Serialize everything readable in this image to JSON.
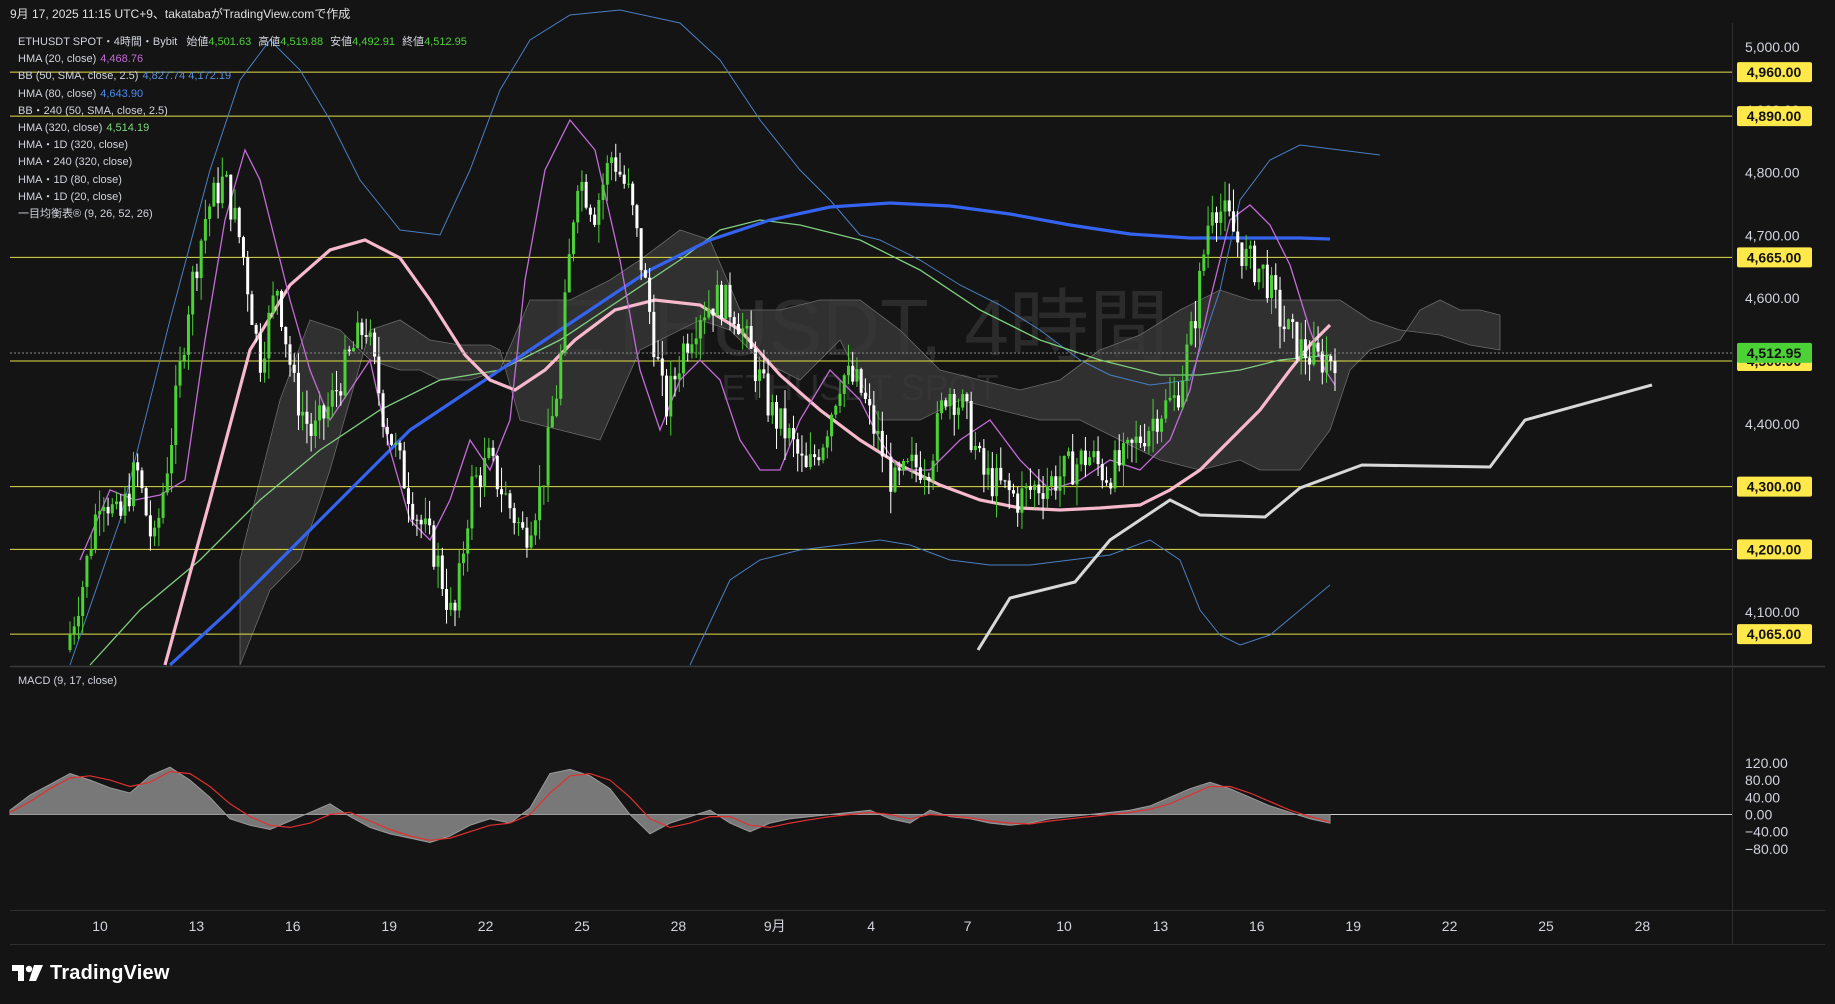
{
  "header": {
    "caption": "9月 17, 2025 11:15 UTC+9、takatabaがTradingView.comで作成"
  },
  "watermark": {
    "title": "ETHUSDT, 4時間",
    "subtitle": "ETHUSDT SPOT"
  },
  "legend": {
    "ohlc": {
      "symbol": "ETHUSDT SPOT・4時間・Bybit",
      "open_label": "始値",
      "open": "4,501.63",
      "high_label": "高値",
      "high": "4,519.88",
      "low_label": "安値",
      "low": "4,492.91",
      "close_label": "終値",
      "close": "4,512.95"
    },
    "indicators": [
      {
        "label": "HMA (20, close)",
        "value": "4,468.76",
        "color": "#c36bd8"
      },
      {
        "label": "BB (50, SMA, close, 2.5)",
        "value": "4,827.74  4,172.19",
        "color": "#5b8fd6"
      },
      {
        "label": "HMA (80, close)",
        "value": "4,643.90",
        "color": "#4a8cf0"
      },
      {
        "label": "BB・240 (50, SMA, close, 2.5)",
        "value": "",
        "color": "#5b8fd6"
      },
      {
        "label": "HMA (320, close)",
        "value": "4,514.19",
        "color": "#7ed67e"
      },
      {
        "label": "HMA・1D (320, close)",
        "value": "",
        "color": "#d1d4dc"
      },
      {
        "label": "HMA・240 (320, close)",
        "value": "",
        "color": "#d1d4dc"
      },
      {
        "label": "HMA・1D (80, close)",
        "value": "",
        "color": "#d1d4dc"
      },
      {
        "label": "HMA・1D (20, close)",
        "value": "",
        "color": "#d1d4dc"
      },
      {
        "label": "一目均衡表® (9, 26, 52, 26)",
        "value": "",
        "color": "#d1d4dc"
      }
    ]
  },
  "macd": {
    "label": "MACD (9, 17, close)"
  },
  "brand": {
    "name": "TradingView"
  },
  "colors": {
    "bg": "#141414",
    "up": "#4cd137",
    "down": "#ffffff",
    "level": "#e5e04a",
    "badge": "#ffe94a",
    "current": "#4cd137"
  },
  "chart_data": [
    {
      "type": "line",
      "title": "ETHUSDT, 4時間",
      "yaxis_ticks": [
        "5,000.00",
        "4,900.00",
        "4,800.00",
        "4,700.00",
        "4,600.00",
        "4,400.00",
        "4,100.00"
      ],
      "ylim": [
        4040,
        5025
      ],
      "xaxis_ticks": [
        "10",
        "13",
        "16",
        "19",
        "22",
        "25",
        "28",
        "9月",
        "4",
        "7",
        "10",
        "13",
        "16",
        "19",
        "22",
        "25",
        "28"
      ],
      "horizontal_levels": [
        {
          "price": 4960,
          "label": "4,960.00"
        },
        {
          "price": 4890,
          "label": "4,890.00"
        },
        {
          "price": 4665,
          "label": "4,665.00"
        },
        {
          "price": 4500,
          "label": "4,500.00"
        },
        {
          "price": 4300,
          "label": "4,300.00"
        },
        {
          "price": 4200,
          "label": "4,200.00"
        },
        {
          "price": 4065,
          "label": "4,065.00"
        }
      ],
      "current_price": {
        "price": 4512.95,
        "label": "4,512.95"
      },
      "price_path": [
        [
          0,
          4040
        ],
        [
          1,
          4150
        ],
        [
          2,
          4300
        ],
        [
          3,
          4240
        ],
        [
          4,
          4330
        ],
        [
          5,
          4200
        ],
        [
          6,
          4380
        ],
        [
          7,
          4600
        ],
        [
          8,
          4740
        ],
        [
          9,
          4790
        ],
        [
          10,
          4680
        ],
        [
          11,
          4500
        ],
        [
          12,
          4620
        ],
        [
          13,
          4450
        ],
        [
          14,
          4380
        ],
        [
          15,
          4430
        ],
        [
          16,
          4500
        ],
        [
          17,
          4560
        ],
        [
          18,
          4420
        ],
        [
          19,
          4330
        ],
        [
          20,
          4250
        ],
        [
          21,
          4190
        ],
        [
          22,
          4080
        ],
        [
          23,
          4300
        ],
        [
          24,
          4340
        ],
        [
          25,
          4280
        ],
        [
          26,
          4220
        ],
        [
          27,
          4300
        ],
        [
          28,
          4480
        ],
        [
          29,
          4800
        ],
        [
          30,
          4740
        ],
        [
          31,
          4830
        ],
        [
          32,
          4760
        ],
        [
          33,
          4600
        ],
        [
          34,
          4420
        ],
        [
          35,
          4520
        ],
        [
          36,
          4580
        ],
        [
          37,
          4600
        ],
        [
          38,
          4580
        ],
        [
          39,
          4500
        ],
        [
          40,
          4420
        ],
        [
          41,
          4380
        ],
        [
          42,
          4320
        ],
        [
          43,
          4380
        ],
        [
          44,
          4480
        ],
        [
          45,
          4460
        ],
        [
          46,
          4380
        ],
        [
          47,
          4300
        ],
        [
          48,
          4330
        ],
        [
          49,
          4340
        ],
        [
          50,
          4460
        ],
        [
          51,
          4420
        ],
        [
          52,
          4320
        ],
        [
          53,
          4300
        ],
        [
          54,
          4280
        ],
        [
          55,
          4300
        ],
        [
          56,
          4310
        ],
        [
          57,
          4330
        ],
        [
          58,
          4350
        ],
        [
          59,
          4320
        ],
        [
          60,
          4340
        ],
        [
          61,
          4380
        ],
        [
          62,
          4420
        ],
        [
          63,
          4440
        ],
        [
          64,
          4560
        ],
        [
          65,
          4760
        ],
        [
          66,
          4720
        ],
        [
          67,
          4660
        ],
        [
          68,
          4640
        ],
        [
          69,
          4560
        ],
        [
          70,
          4520
        ],
        [
          71,
          4500
        ],
        [
          72,
          4510
        ]
      ]
    },
    {
      "type": "area",
      "title": "MACD (9, 17, close)",
      "yaxis_ticks": [
        "120.00",
        "80.00",
        "40.00",
        "0.00",
        "−40.00",
        "−80.00"
      ],
      "ylim": [
        -80,
        120
      ],
      "macd": [
        10,
        45,
        70,
        95,
        80,
        62,
        50,
        90,
        110,
        80,
        40,
        -10,
        -25,
        -35,
        -15,
        5,
        25,
        -5,
        -30,
        -45,
        -55,
        -65,
        -50,
        -25,
        -10,
        -20,
        15,
        95,
        105,
        90,
        60,
        0,
        -45,
        -20,
        -5,
        10,
        -20,
        -40,
        -20,
        -10,
        -5,
        0,
        5,
        10,
        -10,
        -20,
        10,
        -5,
        -10,
        -20,
        -25,
        -20,
        -10,
        -5,
        0,
        5,
        10,
        20,
        40,
        60,
        75,
        60,
        40,
        20,
        5,
        -10,
        -20
      ],
      "signal": [
        5,
        30,
        60,
        85,
        90,
        80,
        65,
        75,
        100,
        95,
        65,
        25,
        -5,
        -25,
        -30,
        -20,
        0,
        5,
        -15,
        -35,
        -50,
        -60,
        -55,
        -40,
        -25,
        -20,
        0,
        50,
        90,
        95,
        80,
        40,
        -10,
        -30,
        -20,
        -5,
        -5,
        -25,
        -30,
        -20,
        -12,
        -5,
        0,
        5,
        0,
        -10,
        0,
        -3,
        -8,
        -15,
        -20,
        -22,
        -15,
        -10,
        -5,
        0,
        5,
        12,
        25,
        45,
        65,
        65,
        50,
        30,
        10,
        -5,
        -18
      ]
    }
  ]
}
